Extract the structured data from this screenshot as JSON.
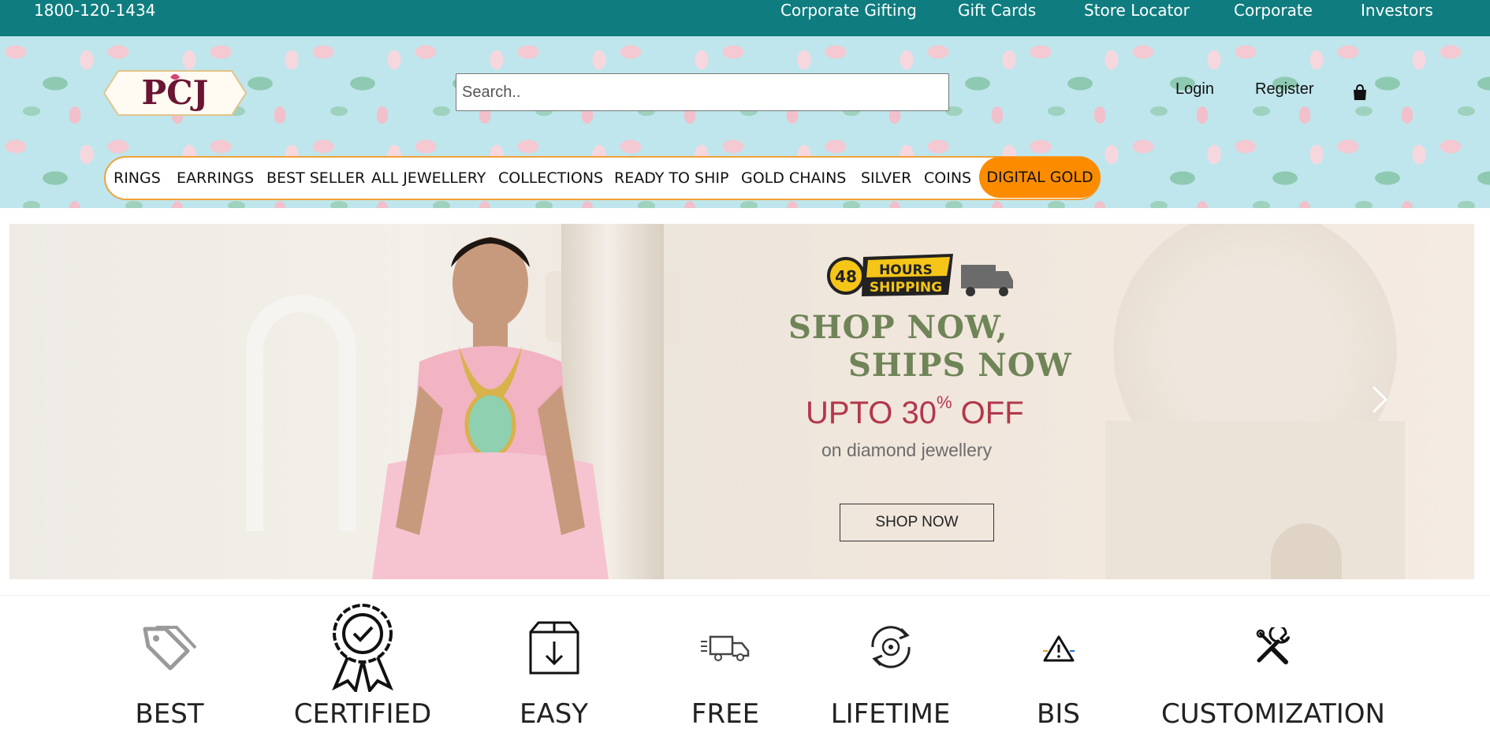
{
  "topbar": {
    "phone": "1800-120-1434",
    "links": [
      "Corporate Gifting",
      "Gift Cards",
      "Store Locator",
      "Corporate",
      "Investors"
    ]
  },
  "header": {
    "logo_text": "PCJ",
    "search_placeholder": "Search..",
    "login": "Login",
    "register": "Register",
    "cart_icon": "shopping-bag-icon"
  },
  "nav": {
    "items": [
      "RINGS",
      "EARRINGS",
      "BEST SELLER",
      "ALL JEWELLERY",
      "COLLECTIONS",
      "READY TO SHIP",
      "GOLD CHAINS",
      "SILVER",
      "COINS"
    ],
    "highlight": "DIGITAL GOLD",
    "highlight_color": "#fb8c00"
  },
  "banner": {
    "badge_number": "48",
    "badge_line1": "HOURS",
    "badge_line2": "SHIPPING",
    "title_line1": "SHOP NOW,",
    "title_line2": "SHIPS NOW",
    "offer_prefix": "UPTO 30",
    "offer_sup": "%",
    "offer_suffix": " OFF",
    "subtitle": "on diamond jewellery",
    "cta": "SHOP NOW",
    "title_color": "#6f8457",
    "offer_color": "#b3374a"
  },
  "features": [
    {
      "label": "BEST",
      "icon": "price-tag-icon"
    },
    {
      "label": "CERTIFIED",
      "icon": "certified-badge-icon"
    },
    {
      "label": "EASY",
      "icon": "return-box-icon"
    },
    {
      "label": "FREE",
      "icon": "delivery-truck-icon"
    },
    {
      "label": "LIFETIME",
      "icon": "lifetime-exchange-icon"
    },
    {
      "label": "BIS",
      "icon": "bis-hallmark-icon"
    },
    {
      "label": "CUSTOMIZATION",
      "icon": "tools-icon"
    }
  ],
  "colors": {
    "topbar": "#0f7d80",
    "nav_border": "#f0a13a",
    "logo": "#6a1533"
  }
}
